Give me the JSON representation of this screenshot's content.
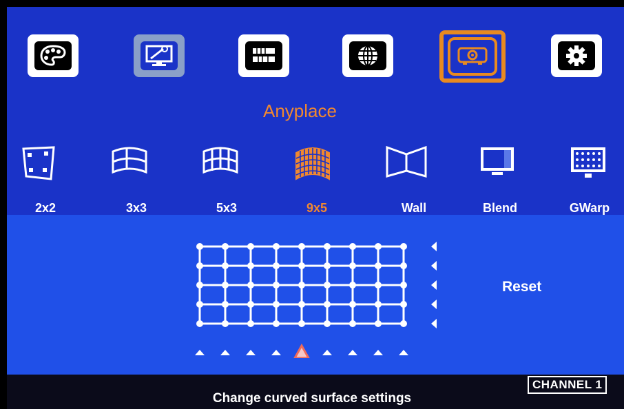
{
  "top_menu": {
    "items": [
      {
        "icon": "palette-icon"
      },
      {
        "icon": "monitor-tools-icon"
      },
      {
        "icon": "signal-input-icon"
      },
      {
        "icon": "globe-network-icon"
      },
      {
        "icon": "projector-icon",
        "active": true
      },
      {
        "icon": "gear-icon"
      }
    ],
    "active_title": "Anyplace"
  },
  "modes": [
    {
      "label": "2x2",
      "icon": "quad-corner-icon"
    },
    {
      "label": "3x3",
      "icon": "curved-3x3-icon"
    },
    {
      "label": "5x3",
      "icon": "curved-5x3-icon"
    },
    {
      "label": "9x5",
      "icon": "curved-9x5-icon",
      "selected": true
    },
    {
      "label": "Wall",
      "icon": "wall-corner-icon"
    },
    {
      "label": "Blend",
      "icon": "blend-screen-icon"
    },
    {
      "label": "GWarp",
      "icon": "grid-warp-icon"
    }
  ],
  "grid": {
    "columns": 9,
    "rows": 5,
    "selected_column": 5
  },
  "reset_label": "Reset",
  "status_text": "Change curved surface settings",
  "channel_label": "CHANNEL 1",
  "colors": {
    "menu_bg": "#1a33c8",
    "panel_bg": "#2050e8",
    "accent": "#f08830",
    "status_bg": "#0b0b1a"
  }
}
